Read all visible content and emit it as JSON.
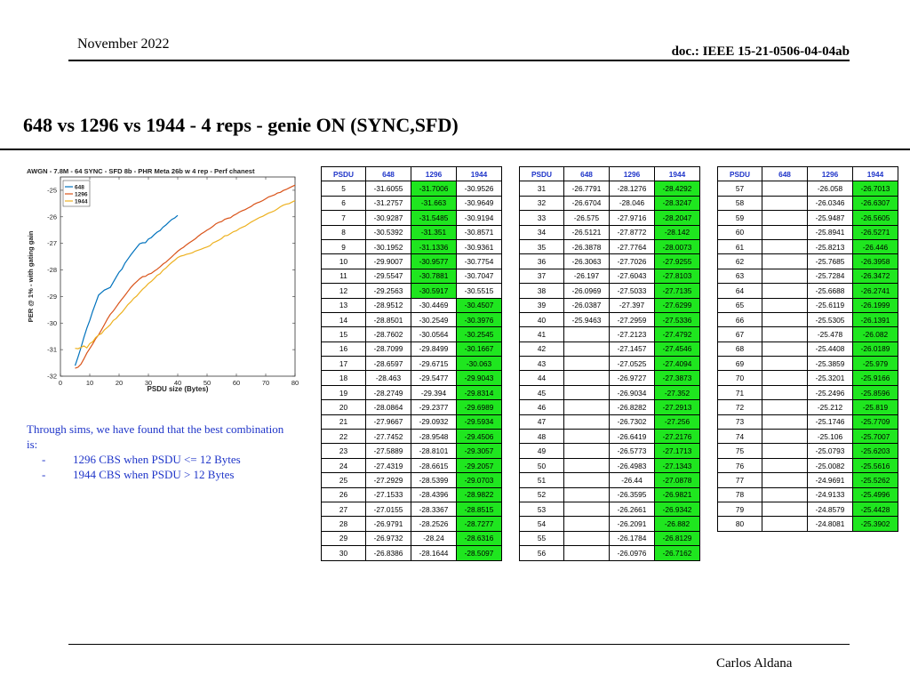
{
  "header": {
    "date": "November 2022",
    "doc": "doc.: IEEE 15-21-0506-04-04ab"
  },
  "title": "648 vs 1296 vs 1944 - 4 reps - genie ON (SYNC,SFD)",
  "footer": {
    "author": "Carlos Aldana"
  },
  "note": {
    "intro": "Through sims, we have found that the best combination is:",
    "items": [
      "1296 CBS when PSDU <= 12 Bytes",
      "1944 CBS when PSDU > 12 Bytes"
    ]
  },
  "colors": {
    "green": "#1fe61f",
    "blue": "#0072bd",
    "orange": "#d95319",
    "yellow": "#edb120",
    "header_text": "#1f35c9"
  },
  "tables": {
    "headers": [
      "PSDU",
      "648",
      "1296",
      "1944"
    ],
    "t1": [
      [
        "5",
        "-31.6055",
        "-31.7006",
        "-30.9526",
        2
      ],
      [
        "6",
        "-31.2757",
        "-31.663",
        "-30.9649",
        2
      ],
      [
        "7",
        "-30.9287",
        "-31.5485",
        "-30.9194",
        2
      ],
      [
        "8",
        "-30.5392",
        "-31.351",
        "-30.8571",
        2
      ],
      [
        "9",
        "-30.1952",
        "-31.1336",
        "-30.9361",
        2
      ],
      [
        "10",
        "-29.9007",
        "-30.9577",
        "-30.7754",
        2
      ],
      [
        "11",
        "-29.5547",
        "-30.7881",
        "-30.7047",
        2
      ],
      [
        "12",
        "-29.2563",
        "-30.5917",
        "-30.5515",
        2
      ],
      [
        "13",
        "-28.9512",
        "-30.4469",
        "-30.4507",
        3
      ],
      [
        "14",
        "-28.8501",
        "-30.2549",
        "-30.3976",
        3
      ],
      [
        "15",
        "-28.7602",
        "-30.0564",
        "-30.2545",
        3
      ],
      [
        "16",
        "-28.7099",
        "-29.8499",
        "-30.1667",
        3
      ],
      [
        "17",
        "-28.6597",
        "-29.6715",
        "-30.063",
        3
      ],
      [
        "18",
        "-28.463",
        "-29.5477",
        "-29.9043",
        3
      ],
      [
        "19",
        "-28.2749",
        "-29.394",
        "-29.8314",
        3
      ],
      [
        "20",
        "-28.0864",
        "-29.2377",
        "-29.6989",
        3
      ],
      [
        "21",
        "-27.9667",
        "-29.0932",
        "-29.5934",
        3
      ],
      [
        "22",
        "-27.7452",
        "-28.9548",
        "-29.4506",
        3
      ],
      [
        "23",
        "-27.5889",
        "-28.8101",
        "-29.3057",
        3
      ],
      [
        "24",
        "-27.4319",
        "-28.6615",
        "-29.2057",
        3
      ],
      [
        "25",
        "-27.2929",
        "-28.5399",
        "-29.0703",
        3
      ],
      [
        "26",
        "-27.1533",
        "-28.4396",
        "-28.9822",
        3
      ],
      [
        "27",
        "-27.0155",
        "-28.3367",
        "-28.8515",
        3
      ],
      [
        "28",
        "-26.9791",
        "-28.2526",
        "-28.7277",
        3
      ],
      [
        "29",
        "-26.9732",
        "-28.24",
        "-28.6316",
        3
      ],
      [
        "30",
        "-26.8386",
        "-28.1644",
        "-28.5097",
        3
      ]
    ],
    "t2": [
      [
        "31",
        "-26.7791",
        "-28.1276",
        "-28.4292",
        3
      ],
      [
        "32",
        "-26.6704",
        "-28.046",
        "-28.3247",
        3
      ],
      [
        "33",
        "-26.575",
        "-27.9716",
        "-28.2047",
        3
      ],
      [
        "34",
        "-26.5121",
        "-27.8772",
        "-28.142",
        3
      ],
      [
        "35",
        "-26.3878",
        "-27.7764",
        "-28.0073",
        3
      ],
      [
        "36",
        "-26.3063",
        "-27.7026",
        "-27.9255",
        3
      ],
      [
        "37",
        "-26.197",
        "-27.6043",
        "-27.8103",
        3
      ],
      [
        "38",
        "-26.0969",
        "-27.5033",
        "-27.7135",
        3
      ],
      [
        "39",
        "-26.0387",
        "-27.397",
        "-27.6299",
        3
      ],
      [
        "40",
        "-25.9463",
        "-27.2959",
        "-27.5336",
        3
      ],
      [
        "41",
        "",
        "-27.2123",
        "-27.4792",
        3
      ],
      [
        "42",
        "",
        "-27.1457",
        "-27.4546",
        3
      ],
      [
        "43",
        "",
        "-27.0525",
        "-27.4094",
        3
      ],
      [
        "44",
        "",
        "-26.9727",
        "-27.3873",
        3
      ],
      [
        "45",
        "",
        "-26.9034",
        "-27.352",
        3
      ],
      [
        "46",
        "",
        "-26.8282",
        "-27.2913",
        3
      ],
      [
        "47",
        "",
        "-26.7302",
        "-27.256",
        3
      ],
      [
        "48",
        "",
        "-26.6419",
        "-27.2176",
        3
      ],
      [
        "49",
        "",
        "-26.5773",
        "-27.1713",
        3
      ],
      [
        "50",
        "",
        "-26.4983",
        "-27.1343",
        3
      ],
      [
        "51",
        "",
        "-26.44",
        "-27.0878",
        3
      ],
      [
        "52",
        "",
        "-26.3595",
        "-26.9821",
        3
      ],
      [
        "53",
        "",
        "-26.2661",
        "-26.9342",
        3
      ],
      [
        "54",
        "",
        "-26.2091",
        "-26.882",
        3
      ],
      [
        "55",
        "",
        "-26.1784",
        "-26.8129",
        3
      ],
      [
        "56",
        "",
        "-26.0976",
        "-26.7162",
        3
      ]
    ],
    "t3": [
      [
        "57",
        "",
        "-26.058",
        "-26.7013",
        3
      ],
      [
        "58",
        "",
        "-26.0346",
        "-26.6307",
        3
      ],
      [
        "59",
        "",
        "-25.9487",
        "-26.5605",
        3
      ],
      [
        "60",
        "",
        "-25.8941",
        "-26.5271",
        3
      ],
      [
        "61",
        "",
        "-25.8213",
        "-26.446",
        3
      ],
      [
        "62",
        "",
        "-25.7685",
        "-26.3958",
        3
      ],
      [
        "63",
        "",
        "-25.7284",
        "-26.3472",
        3
      ],
      [
        "64",
        "",
        "-25.6688",
        "-26.2741",
        3
      ],
      [
        "65",
        "",
        "-25.6119",
        "-26.1999",
        3
      ],
      [
        "66",
        "",
        "-25.5305",
        "-26.1391",
        3
      ],
      [
        "67",
        "",
        "-25.478",
        "-26.082",
        3
      ],
      [
        "68",
        "",
        "-25.4408",
        "-26.0189",
        3
      ],
      [
        "69",
        "",
        "-25.3859",
        "-25.979",
        3
      ],
      [
        "70",
        "",
        "-25.3201",
        "-25.9166",
        3
      ],
      [
        "71",
        "",
        "-25.2496",
        "-25.8596",
        3
      ],
      [
        "72",
        "",
        "-25.212",
        "-25.819",
        3
      ],
      [
        "73",
        "",
        "-25.1746",
        "-25.7709",
        3
      ],
      [
        "74",
        "",
        "-25.106",
        "-25.7007",
        3
      ],
      [
        "75",
        "",
        "-25.0793",
        "-25.6203",
        3
      ],
      [
        "76",
        "",
        "-25.0082",
        "-25.5616",
        3
      ],
      [
        "77",
        "",
        "-24.9691",
        "-25.5262",
        3
      ],
      [
        "78",
        "",
        "-24.9133",
        "-25.4996",
        3
      ],
      [
        "79",
        "",
        "-24.8579",
        "-25.4428",
        3
      ],
      [
        "80",
        "",
        "-24.8081",
        "-25.3902",
        3
      ]
    ]
  },
  "chart_data": {
    "type": "line",
    "title": "AWGN - 7.8M - 64 SYNC - SFD 8b - PHR Meta 26b w 4 rep - Perf chanest",
    "xlabel": "PSDU size (Bytes)",
    "ylabel": "PER @ 1% - with gating gain",
    "xlim": [
      0,
      80
    ],
    "ylim": [
      -32,
      -24.5
    ],
    "xticks": [
      0,
      10,
      20,
      30,
      40,
      50,
      60,
      70,
      80
    ],
    "yticks": [
      -32,
      -31,
      -30,
      -29,
      -28,
      -27,
      -26,
      -25
    ],
    "legend_position": "top-left",
    "grid": false,
    "series": [
      {
        "name": "648",
        "color": "#0072bd",
        "x": [
          5,
          6,
          7,
          8,
          9,
          10,
          11,
          12,
          13,
          14,
          15,
          16,
          17,
          18,
          19,
          20,
          21,
          22,
          23,
          24,
          25,
          26,
          27,
          28,
          29,
          30,
          31,
          32,
          33,
          34,
          35,
          36,
          37,
          38,
          39,
          40
        ],
        "y": [
          -31.6055,
          -31.2757,
          -30.9287,
          -30.5392,
          -30.1952,
          -29.9007,
          -29.5547,
          -29.2563,
          -28.9512,
          -28.8501,
          -28.7602,
          -28.7099,
          -28.6597,
          -28.463,
          -28.2749,
          -28.0864,
          -27.9667,
          -27.7452,
          -27.5889,
          -27.4319,
          -27.2929,
          -27.1533,
          -27.0155,
          -26.9791,
          -26.9732,
          -26.8386,
          -26.7791,
          -26.6704,
          -26.575,
          -26.5121,
          -26.3878,
          -26.3063,
          -26.197,
          -26.0969,
          -26.0387,
          -25.9463
        ]
      },
      {
        "name": "1296",
        "color": "#d95319",
        "x": [
          5,
          6,
          7,
          8,
          9,
          10,
          11,
          12,
          13,
          14,
          15,
          16,
          17,
          18,
          19,
          20,
          21,
          22,
          23,
          24,
          25,
          26,
          27,
          28,
          29,
          30,
          31,
          32,
          33,
          34,
          35,
          36,
          37,
          38,
          39,
          40,
          41,
          42,
          43,
          44,
          45,
          46,
          47,
          48,
          49,
          50,
          51,
          52,
          53,
          54,
          55,
          56,
          57,
          58,
          59,
          60,
          61,
          62,
          63,
          64,
          65,
          66,
          67,
          68,
          69,
          70,
          71,
          72,
          73,
          74,
          75,
          76,
          77,
          78,
          79,
          80
        ],
        "y": [
          -31.7006,
          -31.663,
          -31.5485,
          -31.351,
          -31.1336,
          -30.9577,
          -30.7881,
          -30.5917,
          -30.4469,
          -30.2549,
          -30.0564,
          -29.8499,
          -29.6715,
          -29.5477,
          -29.394,
          -29.2377,
          -29.0932,
          -28.9548,
          -28.8101,
          -28.6615,
          -28.5399,
          -28.4396,
          -28.3367,
          -28.2526,
          -28.24,
          -28.1644,
          -28.1276,
          -28.046,
          -27.9716,
          -27.8772,
          -27.7764,
          -27.7026,
          -27.6043,
          -27.5033,
          -27.397,
          -27.2959,
          -27.2123,
          -27.1457,
          -27.0525,
          -26.9727,
          -26.9034,
          -26.8282,
          -26.7302,
          -26.6419,
          -26.5773,
          -26.4983,
          -26.44,
          -26.3595,
          -26.2661,
          -26.2091,
          -26.1784,
          -26.0976,
          -26.058,
          -26.0346,
          -25.9487,
          -25.8941,
          -25.8213,
          -25.7685,
          -25.7284,
          -25.6688,
          -25.6119,
          -25.5305,
          -25.478,
          -25.4408,
          -25.3859,
          -25.3201,
          -25.2496,
          -25.212,
          -25.1746,
          -25.106,
          -25.0793,
          -25.0082,
          -24.9691,
          -24.9133,
          -24.8579,
          -24.8081
        ]
      },
      {
        "name": "1944",
        "color": "#edb120",
        "x": [
          5,
          6,
          7,
          8,
          9,
          10,
          11,
          12,
          13,
          14,
          15,
          16,
          17,
          18,
          19,
          20,
          21,
          22,
          23,
          24,
          25,
          26,
          27,
          28,
          29,
          30,
          31,
          32,
          33,
          34,
          35,
          36,
          37,
          38,
          39,
          40,
          41,
          42,
          43,
          44,
          45,
          46,
          47,
          48,
          49,
          50,
          51,
          52,
          53,
          54,
          55,
          56,
          57,
          58,
          59,
          60,
          61,
          62,
          63,
          64,
          65,
          66,
          67,
          68,
          69,
          70,
          71,
          72,
          73,
          74,
          75,
          76,
          77,
          78,
          79,
          80
        ],
        "y": [
          -30.9526,
          -30.9649,
          -30.9194,
          -30.8571,
          -30.9361,
          -30.7754,
          -30.7047,
          -30.5515,
          -30.4507,
          -30.3976,
          -30.2545,
          -30.1667,
          -30.063,
          -29.9043,
          -29.8314,
          -29.6989,
          -29.5934,
          -29.4506,
          -29.3057,
          -29.2057,
          -29.0703,
          -28.9822,
          -28.8515,
          -28.7277,
          -28.6316,
          -28.5097,
          -28.4292,
          -28.3247,
          -28.2047,
          -28.142,
          -28.0073,
          -27.9255,
          -27.8103,
          -27.7135,
          -27.6299,
          -27.5336,
          -27.4792,
          -27.4546,
          -27.4094,
          -27.3873,
          -27.352,
          -27.2913,
          -27.256,
          -27.2176,
          -27.1713,
          -27.1343,
          -27.0878,
          -26.9821,
          -26.9342,
          -26.882,
          -26.8129,
          -26.7162,
          -26.7013,
          -26.6307,
          -26.5605,
          -26.5271,
          -26.446,
          -26.3958,
          -26.3472,
          -26.2741,
          -26.1999,
          -26.1391,
          -26.082,
          -26.0189,
          -25.979,
          -25.9166,
          -25.8596,
          -25.819,
          -25.7709,
          -25.7007,
          -25.6203,
          -25.5616,
          -25.5262,
          -25.4996,
          -25.4428,
          -25.3902
        ]
      }
    ]
  }
}
